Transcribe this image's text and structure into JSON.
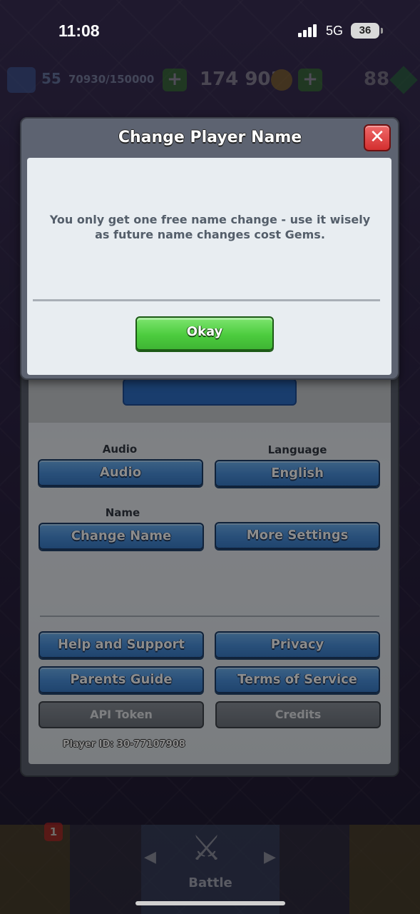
{
  "status_bar": {
    "time": "11:08",
    "network": "5G",
    "battery": "36"
  },
  "hud": {
    "level": "55",
    "xp": "70930/150000",
    "gold": "174 903",
    "gems": "88"
  },
  "dialog": {
    "title": "Change Player Name",
    "message": "You only get one free name change - use it wisely as future name changes cost Gems.",
    "okay_label": "Okay",
    "close_icon": "close-icon"
  },
  "settings": {
    "audio_label": "Audio",
    "audio_button": "Audio",
    "language_label": "Language",
    "language_button": "English",
    "name_label": "Name",
    "change_name_button": "Change Name",
    "more_settings_button": "More Settings",
    "help_button": "Help and Support",
    "privacy_button": "Privacy",
    "parents_button": "Parents Guide",
    "terms_button": "Terms of Service",
    "api_token_button": "API Token",
    "credits_button": "Credits",
    "player_id": "Player ID: 30-77107908"
  },
  "bottom_nav": {
    "battle_label": "Battle",
    "shop_badge": "1"
  },
  "colors": {
    "accent_green": "#4ccc3e",
    "accent_blue": "#4a90dd",
    "close_red": "#d32f2f"
  }
}
